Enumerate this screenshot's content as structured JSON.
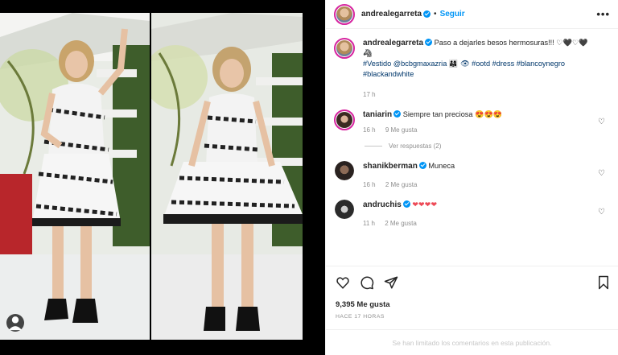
{
  "header": {
    "username": "andrealegarreta",
    "separator": "•",
    "follow_label": "Seguir",
    "more_icon": "ellipsis-icon"
  },
  "caption": {
    "username": "andrealegarreta",
    "text": "Paso a dejarles besos hermosuras!!! ♡🖤♡🖤🦓",
    "hashtags": "#Vestido @bcbgmaxazria 👨‍👩‍👧 👁 #ootd #dress #blancoynegro #blackandwhite",
    "time": "17 h"
  },
  "comments": [
    {
      "username": "taniarin",
      "text": "Siempre tan preciosa 😍😍😍",
      "time": "16 h",
      "likes": "9 Me gusta",
      "replies": "Ver respuestas (2)"
    },
    {
      "username": "shanikberman",
      "text": "Muneca",
      "time": "16 h",
      "likes": "2 Me gusta"
    },
    {
      "username": "andruchis",
      "text": "❤❤❤❤",
      "time": "11 h",
      "likes": "2 Me gusta"
    }
  ],
  "actions": {
    "like_icon": "heart-outline-icon",
    "comment_icon": "comment-icon",
    "share_icon": "share-icon",
    "save_icon": "bookmark-icon"
  },
  "likes_count": "9,395 Me gusta",
  "timestamp": "HACE 17 HORAS",
  "comments_limited": "Se han limitado los comentarios en esta publicación.",
  "colors": {
    "accent": "#0095f6",
    "heart_red": "#ed4956",
    "link": "#00376b",
    "muted": "#8e8e8e"
  }
}
